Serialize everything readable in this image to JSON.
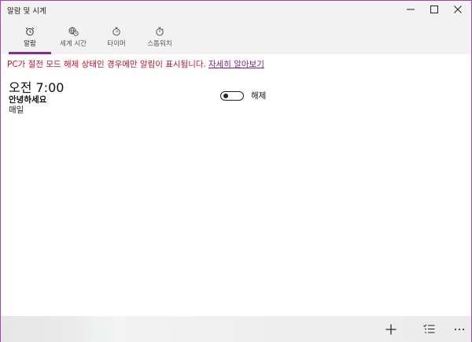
{
  "window": {
    "title": "알람 및 시계"
  },
  "tabs": [
    {
      "label": "알람",
      "icon": "alarm-clock-icon",
      "active": true
    },
    {
      "label": "세계 시간",
      "icon": "world-clock-icon",
      "active": false
    },
    {
      "label": "타이머",
      "icon": "timer-icon",
      "active": false
    },
    {
      "label": "스톱워치",
      "icon": "stopwatch-icon",
      "active": false
    }
  ],
  "notice": {
    "text": "PC가 절전 모드 해제 상태인 경우에만 알림이 표시됩니다.",
    "link": "자세히 알아보기"
  },
  "alarm": {
    "time": "오전 7:00",
    "name": "안녕하세요",
    "repeat": "매일",
    "toggle_state": "해제",
    "enabled": false
  },
  "colors": {
    "accent": "#8a2a94",
    "notice": "#c8102e",
    "link": "#7a1f86"
  },
  "bottombar": {
    "icons": [
      "add-icon",
      "select-list-icon",
      "more-icon"
    ]
  }
}
